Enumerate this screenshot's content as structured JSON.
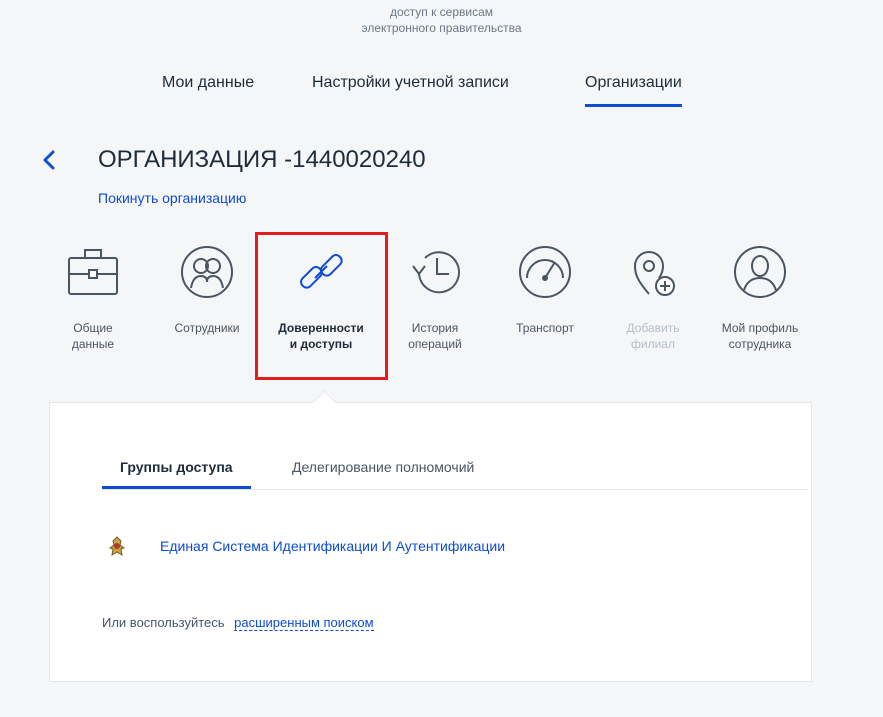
{
  "header": {
    "caption_line1": "доступ к сервисам",
    "caption_line2": "электронного правительства"
  },
  "main_tabs": [
    {
      "label": "Мои данные",
      "active": false
    },
    {
      "label": "Настройки учетной записи",
      "active": false
    },
    {
      "label": "Организации",
      "active": true
    }
  ],
  "organization": {
    "title": "ОРГАНИЗАЦИЯ -1440020240",
    "leave_link": "Покинуть организацию"
  },
  "sections": [
    {
      "label": "Общие\nданные",
      "icon": "briefcase-icon"
    },
    {
      "label": "Сотрудники",
      "icon": "employees-icon"
    },
    {
      "label": "Доверенности\nи доступы",
      "icon": "chain-link-icon",
      "active": true
    },
    {
      "label": "История\nопераций",
      "icon": "history-icon"
    },
    {
      "label": "Транспорт",
      "icon": "speedometer-icon"
    },
    {
      "label": "Добавить\nфилиал",
      "icon": "add-location-icon",
      "disabled": true
    },
    {
      "label": "Мой профиль\nсотрудника",
      "icon": "profile-icon"
    }
  ],
  "sub_tabs": [
    {
      "label": "Группы доступа",
      "active": true
    },
    {
      "label": "Делегирование полномочий",
      "active": false
    }
  ],
  "access_groups": [
    {
      "label": "Единая Система Идентификации И Аутентификации",
      "icon": "esia-emblem-icon"
    }
  ],
  "alt_search": {
    "prefix": "Или воспользуйтесь",
    "link": "расширенным поиском"
  },
  "colors": {
    "accent": "#0d4cd3",
    "highlight": "#e31c1c",
    "background": "#f5f6f8"
  }
}
